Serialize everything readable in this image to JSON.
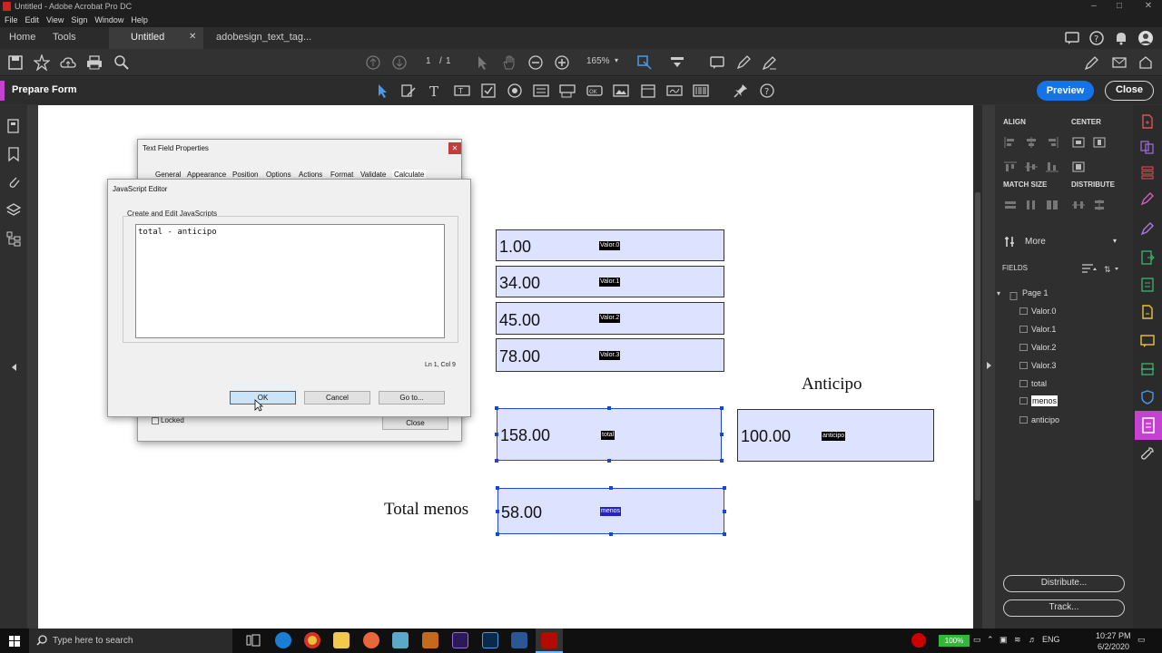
{
  "window": {
    "title": "Untitled - Adobe Acrobat Pro DC"
  },
  "menu": [
    "File",
    "Edit",
    "View",
    "Sign",
    "Window",
    "Help"
  ],
  "tabs": {
    "home": "Home",
    "tools": "Tools",
    "doc1": "Untitled",
    "doc2": "adobesign_text_tag..."
  },
  "toolbar": {
    "page_current": "1",
    "page_sep": "/",
    "page_total": "1",
    "zoom": "165%"
  },
  "prepare": {
    "title": "Prepare Form",
    "preview": "Preview",
    "close": "Close"
  },
  "document": {
    "fields": [
      {
        "value": "1.00",
        "name": "Valor.0"
      },
      {
        "value": "34.00",
        "name": "Valor.1"
      },
      {
        "value": "45.00",
        "name": "Valor.2"
      },
      {
        "value": "78.00",
        "name": "Valor.3"
      },
      {
        "value": "158.00",
        "name": "total"
      },
      {
        "value": "100.00",
        "name": "anticipo"
      },
      {
        "value": "58.00",
        "name": "menos"
      }
    ],
    "labels": {
      "anticipo": "Anticipo",
      "total_menos": "Total menos"
    }
  },
  "props_dialog": {
    "title": "Text Field Properties",
    "tabs": [
      "General",
      "Appearance",
      "Position",
      "Options",
      "Actions",
      "Format",
      "Validate",
      "Calculate"
    ],
    "locked": "Locked",
    "close": "Close"
  },
  "js_editor": {
    "title": "JavaScript Editor",
    "group_label": "Create and Edit JavaScripts",
    "code": "total - anticipo",
    "status": "Ln 1, Col 9",
    "ok": "OK",
    "cancel": "Cancel",
    "goto": "Go to..."
  },
  "right_panel": {
    "align": "ALIGN",
    "center": "CENTER",
    "match_size": "MATCH SIZE",
    "distribute": "DISTRIBUTE",
    "more": "More",
    "fields_heading": "FIELDS",
    "page": "Page 1",
    "field_list": [
      "Valor.0",
      "Valor.1",
      "Valor.2",
      "Valor.3",
      "total",
      "menos",
      "anticipo"
    ],
    "selected_field": "menos",
    "distribute_btn": "Distribute...",
    "track_btn": "Track..."
  },
  "taskbar": {
    "search_placeholder": "Type here to search",
    "battery": "100%",
    "lang": "ENG",
    "time": "10:27 PM",
    "date": "6/2/2020"
  },
  "colors": {
    "accent": "#1473e6",
    "prepare_accent": "#c542d1",
    "field_fill": "#dde2ff",
    "selection": "#2448d8"
  }
}
